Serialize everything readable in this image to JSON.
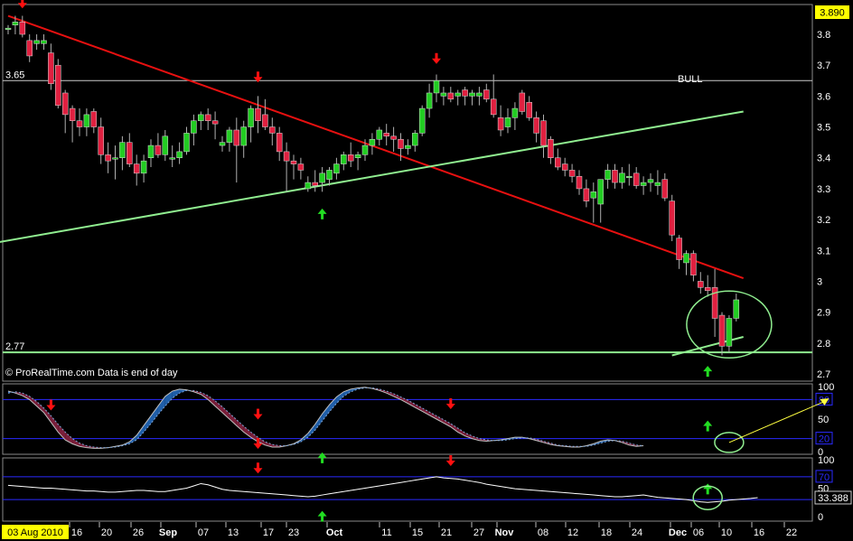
{
  "chart_data": [
    {
      "type": "candlestick",
      "panel": "price",
      "notes": {
        "source": "© ProRealTime.com  Data is end of day",
        "bull_label": "BULL"
      },
      "price_badge": "3.890",
      "ylim": [
        2.7,
        3.92
      ],
      "y_ticks": [
        "3.8",
        "3.7",
        "3.6",
        "3.5",
        "3.4",
        "3.3",
        "3.2",
        "3.1",
        "3",
        "2.9",
        "2.8",
        "2.7"
      ],
      "x_labels": [
        "03 Aug 2010",
        "16",
        "20",
        "26",
        "Sep",
        "07",
        "13",
        "17",
        "23",
        "Oct",
        "11",
        "15",
        "21",
        "27",
        "Nov",
        "08",
        "12",
        "18",
        "24",
        "Dec",
        "06",
        "10",
        "16",
        "22"
      ],
      "hlines": [
        {
          "label": "3.65",
          "value": 3.65,
          "color": "#cccccc"
        },
        {
          "label": "2.77",
          "value": 2.77,
          "color": "#90ee90"
        }
      ],
      "candles": [
        [
          3.82,
          3.83,
          3.8,
          3.82
        ],
        [
          3.83,
          3.86,
          3.8,
          3.84
        ],
        [
          3.84,
          3.86,
          3.79,
          3.8
        ],
        [
          3.78,
          3.8,
          3.71,
          3.73
        ],
        [
          3.77,
          3.8,
          3.75,
          3.78
        ],
        [
          3.77,
          3.8,
          3.75,
          3.78
        ],
        [
          3.74,
          3.77,
          3.62,
          3.64
        ],
        [
          3.7,
          3.72,
          3.56,
          3.57
        ],
        [
          3.61,
          3.62,
          3.48,
          3.54
        ],
        [
          3.56,
          3.57,
          3.45,
          3.52
        ],
        [
          3.52,
          3.56,
          3.47,
          3.5
        ],
        [
          3.5,
          3.56,
          3.47,
          3.54
        ],
        [
          3.55,
          3.56,
          3.48,
          3.5
        ],
        [
          3.5,
          3.53,
          3.38,
          3.41
        ],
        [
          3.41,
          3.45,
          3.35,
          3.39
        ],
        [
          3.4,
          3.44,
          3.33,
          3.4
        ],
        [
          3.4,
          3.47,
          3.36,
          3.45
        ],
        [
          3.45,
          3.48,
          3.37,
          3.38
        ],
        [
          3.38,
          3.41,
          3.31,
          3.35
        ],
        [
          3.35,
          3.41,
          3.32,
          3.39
        ],
        [
          3.4,
          3.46,
          3.37,
          3.44
        ],
        [
          3.44,
          3.48,
          3.4,
          3.41
        ],
        [
          3.41,
          3.49,
          3.39,
          3.47
        ],
        [
          3.4,
          3.44,
          3.37,
          3.4
        ],
        [
          3.4,
          3.45,
          3.38,
          3.42
        ],
        [
          3.42,
          3.5,
          3.41,
          3.48
        ],
        [
          3.48,
          3.54,
          3.44,
          3.52
        ],
        [
          3.52,
          3.55,
          3.49,
          3.54
        ],
        [
          3.54,
          3.56,
          3.49,
          3.52
        ],
        [
          3.52,
          3.55,
          3.46,
          3.51
        ],
        [
          3.44,
          3.47,
          3.42,
          3.45
        ],
        [
          3.45,
          3.5,
          3.42,
          3.49
        ],
        [
          3.49,
          3.53,
          3.32,
          3.44
        ],
        [
          3.44,
          3.52,
          3.4,
          3.5
        ],
        [
          3.5,
          3.57,
          3.45,
          3.56
        ],
        [
          3.56,
          3.6,
          3.48,
          3.52
        ],
        [
          3.54,
          3.59,
          3.49,
          3.5
        ],
        [
          3.5,
          3.53,
          3.44,
          3.48
        ],
        [
          3.48,
          3.5,
          3.39,
          3.42
        ],
        [
          3.42,
          3.45,
          3.29,
          3.39
        ],
        [
          3.39,
          3.41,
          3.33,
          3.38
        ],
        [
          3.38,
          3.4,
          3.33,
          3.36
        ],
        [
          3.3,
          3.34,
          3.29,
          3.32
        ],
        [
          3.32,
          3.36,
          3.29,
          3.31
        ],
        [
          3.32,
          3.37,
          3.29,
          3.35
        ],
        [
          3.33,
          3.37,
          3.31,
          3.36
        ],
        [
          3.35,
          3.4,
          3.33,
          3.38
        ],
        [
          3.38,
          3.42,
          3.36,
          3.41
        ],
        [
          3.41,
          3.45,
          3.37,
          3.39
        ],
        [
          3.4,
          3.42,
          3.36,
          3.41
        ],
        [
          3.41,
          3.46,
          3.39,
          3.44
        ],
        [
          3.44,
          3.48,
          3.41,
          3.46
        ],
        [
          3.46,
          3.5,
          3.44,
          3.49
        ],
        [
          3.48,
          3.51,
          3.44,
          3.47
        ],
        [
          3.47,
          3.5,
          3.42,
          3.46
        ],
        [
          3.46,
          3.48,
          3.39,
          3.43
        ],
        [
          3.43,
          3.46,
          3.41,
          3.44
        ],
        [
          3.44,
          3.49,
          3.42,
          3.48
        ],
        [
          3.48,
          3.57,
          3.47,
          3.56
        ],
        [
          3.56,
          3.64,
          3.53,
          3.61
        ],
        [
          3.61,
          3.67,
          3.58,
          3.65
        ],
        [
          3.6,
          3.63,
          3.57,
          3.61
        ],
        [
          3.61,
          3.63,
          3.58,
          3.59
        ],
        [
          3.6,
          3.62,
          3.57,
          3.61
        ],
        [
          3.62,
          3.63,
          3.57,
          3.6
        ],
        [
          3.6,
          3.62,
          3.57,
          3.61
        ],
        [
          3.6,
          3.63,
          3.57,
          3.61
        ],
        [
          3.62,
          3.64,
          3.58,
          3.59
        ],
        [
          3.59,
          3.67,
          3.53,
          3.54
        ],
        [
          3.53,
          3.57,
          3.47,
          3.49
        ],
        [
          3.5,
          3.56,
          3.48,
          3.53
        ],
        [
          3.53,
          3.58,
          3.49,
          3.56
        ],
        [
          3.61,
          3.62,
          3.54,
          3.55
        ],
        [
          3.58,
          3.6,
          3.52,
          3.53
        ],
        [
          3.53,
          3.55,
          3.45,
          3.48
        ],
        [
          3.52,
          3.54,
          3.4,
          3.44
        ],
        [
          3.46,
          3.47,
          3.38,
          3.4
        ],
        [
          3.4,
          3.43,
          3.36,
          3.37
        ],
        [
          3.38,
          3.4,
          3.34,
          3.36
        ],
        [
          3.36,
          3.38,
          3.32,
          3.34
        ],
        [
          3.34,
          3.36,
          3.28,
          3.3
        ],
        [
          3.3,
          3.33,
          3.24,
          3.26
        ],
        [
          3.27,
          3.32,
          3.19,
          3.29
        ],
        [
          3.25,
          3.28,
          3.19,
          3.33
        ],
        [
          3.33,
          3.38,
          3.3,
          3.36
        ],
        [
          3.36,
          3.38,
          3.3,
          3.32
        ],
        [
          3.32,
          3.37,
          3.3,
          3.35
        ],
        [
          3.34,
          3.38,
          3.31,
          3.34
        ],
        [
          3.35,
          3.37,
          3.3,
          3.31
        ],
        [
          3.31,
          3.34,
          3.28,
          3.32
        ],
        [
          3.32,
          3.35,
          3.29,
          3.33
        ],
        [
          3.31,
          3.36,
          3.28,
          3.32
        ],
        [
          3.33,
          3.35,
          3.26,
          3.27
        ],
        [
          3.26,
          3.28,
          3.13,
          3.15
        ],
        [
          3.14,
          3.15,
          3.04,
          3.07
        ],
        [
          3.06,
          3.1,
          3.02,
          3.09
        ],
        [
          3.09,
          3.1,
          3.0,
          3.02
        ],
        [
          3.0,
          3.03,
          2.96,
          2.98
        ],
        [
          2.98,
          3.02,
          2.95,
          2.97
        ],
        [
          2.98,
          3.04,
          2.82,
          2.88
        ],
        [
          2.89,
          2.9,
          2.76,
          2.79
        ],
        [
          2.79,
          2.89,
          2.77,
          2.88
        ],
        [
          2.88,
          2.96,
          2.87,
          2.94
        ]
      ],
      "trendlines": [
        {
          "name": "resistance",
          "color": "#e81010",
          "from": [
            0,
            3.86
          ],
          "to": [
            103,
            3.01
          ]
        },
        {
          "name": "support",
          "color": "#90ee90",
          "from": [
            -3,
            3.12
          ],
          "to": [
            103,
            3.55
          ]
        },
        {
          "name": "support-2",
          "color": "#90ee90",
          "from": [
            93,
            2.76
          ],
          "to": [
            103,
            2.82
          ]
        }
      ],
      "arrows": [
        {
          "type": "down",
          "i": 2,
          "value": 3.89
        },
        {
          "type": "down",
          "i": 35,
          "value": 3.65
        },
        {
          "type": "up",
          "i": 44,
          "value": 3.23
        },
        {
          "type": "down",
          "i": 60,
          "value": 3.71
        },
        {
          "type": "up",
          "i": 98,
          "value": 2.72
        }
      ],
      "circle": {
        "i": 101,
        "value": 2.86,
        "rx": 47,
        "ry": 37
      }
    },
    {
      "type": "line",
      "panel": "oscillator-1",
      "y_ticks": [
        "100",
        "50",
        "0"
      ],
      "levels": [
        {
          "label": "80",
          "value": 80
        },
        {
          "label": "20",
          "value": 20
        }
      ],
      "last_label": "80",
      "main": [
        93,
        90,
        86,
        80,
        70,
        60,
        45,
        30,
        18,
        12,
        8,
        6,
        5,
        5,
        6,
        8,
        10,
        15,
        25,
        40,
        55,
        70,
        85,
        93,
        96,
        95,
        92,
        88,
        80,
        70,
        60,
        50,
        40,
        30,
        22,
        15,
        10,
        7,
        7,
        9,
        12,
        18,
        28,
        42,
        58,
        72,
        84,
        92,
        96,
        98,
        99,
        97,
        94,
        90,
        85,
        80,
        74,
        68,
        62,
        56,
        50,
        44,
        38,
        30,
        24,
        20,
        17,
        16,
        17,
        18,
        20,
        22,
        22,
        20,
        17,
        14,
        11,
        9,
        8,
        7,
        7,
        9,
        12,
        16,
        18,
        17,
        14,
        10,
        8,
        9
      ],
      "signal": [
        90,
        92,
        90,
        85,
        77,
        67,
        55,
        42,
        30,
        20,
        13,
        9,
        7,
        6,
        6,
        7,
        9,
        12,
        18,
        30,
        43,
        57,
        70,
        82,
        90,
        94,
        94,
        91,
        86,
        78,
        69,
        59,
        49,
        39,
        30,
        22,
        15,
        11,
        9,
        9,
        11,
        15,
        22,
        33,
        47,
        61,
        74,
        85,
        92,
        96,
        98,
        98,
        96,
        93,
        89,
        84,
        79,
        73,
        67,
        61,
        55,
        49,
        43,
        36,
        29,
        24,
        20,
        18,
        17,
        17,
        18,
        20,
        21,
        21,
        19,
        16,
        13,
        10,
        9,
        8,
        8,
        8,
        10,
        13,
        16,
        17,
        16,
        13,
        10,
        9
      ],
      "arrows": [
        {
          "type": "down",
          "i": 6,
          "value": 66
        },
        {
          "type": "down",
          "i": 35,
          "value": 52
        },
        {
          "type": "down",
          "i": 35,
          "value": 7
        },
        {
          "type": "up",
          "i": 44,
          "value": -4
        },
        {
          "type": "down",
          "i": 62,
          "value": 68
        },
        {
          "type": "up",
          "i": 98,
          "value": 45
        }
      ],
      "projection": {
        "from": [
          101,
          14
        ],
        "to": [
          115,
          82
        ]
      },
      "circle": {
        "i": 101,
        "value": 14,
        "rx": 16,
        "ry": 11
      }
    },
    {
      "type": "line",
      "panel": "oscillator-2",
      "y_ticks": [
        "100",
        "50",
        "0"
      ],
      "levels": [
        {
          "label": "70",
          "value": 70
        },
        {
          "label": "30",
          "value": 30
        }
      ],
      "last_label": "33.388",
      "values": [
        55,
        54,
        53,
        52,
        51,
        50,
        50,
        49,
        48,
        47,
        46,
        45,
        45,
        44,
        43,
        43,
        44,
        45,
        46,
        46,
        45,
        44,
        44,
        46,
        48,
        50,
        54,
        58,
        56,
        52,
        48,
        46,
        45,
        44,
        43,
        42,
        41,
        40,
        39,
        38,
        37,
        36,
        35,
        36,
        38,
        40,
        42,
        44,
        46,
        48,
        50,
        52,
        54,
        56,
        58,
        60,
        62,
        64,
        66,
        68,
        70,
        68,
        67,
        66,
        64,
        62,
        60,
        57,
        55,
        53,
        51,
        49,
        48,
        47,
        46,
        45,
        44,
        43,
        42,
        41,
        40,
        39,
        38,
        37,
        36,
        35,
        35,
        36,
        37,
        38,
        36,
        34,
        33,
        32,
        31,
        30,
        28,
        26,
        25,
        26,
        27,
        29,
        30,
        31,
        32,
        33.388
      ],
      "arrows": [
        {
          "type": "down",
          "i": 35,
          "value": 79
        },
        {
          "type": "up",
          "i": 44,
          "value": 7
        },
        {
          "type": "down",
          "i": 62,
          "value": 92
        },
        {
          "type": "up",
          "i": 98,
          "value": 55
        }
      ],
      "circle": {
        "i": 98,
        "value": 33,
        "rx": 16,
        "ry": 13
      }
    }
  ]
}
